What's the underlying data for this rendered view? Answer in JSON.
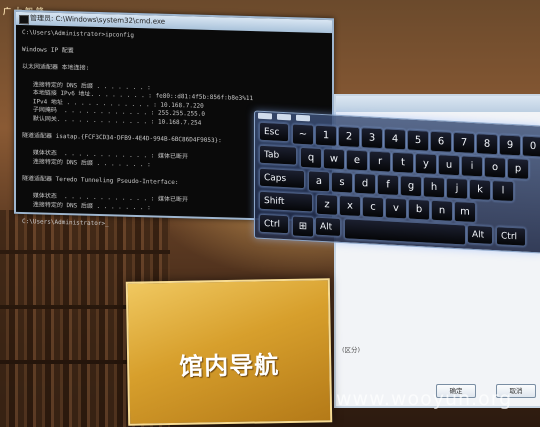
{
  "logo": {
    "text": "广大智锋"
  },
  "console": {
    "title": "管理员: C:\\Windows\\system32\\cmd.exe",
    "lines": [
      "C:\\Users\\Administrator>ipconfig",
      "",
      "Windows IP 配置",
      "",
      "以太网适配器 本地连接:",
      "",
      "   连接特定的 DNS 后缀 . . . . . . . :",
      "   本地链接 IPv6 地址. . . . . . . . : fe80::d81:4f5b:856f:b8e3%11",
      "   IPv4 地址 . . . . . . . . . . . . : 10.168.7.220",
      "   子网掩码  . . . . . . . . . . . . : 255.255.255.0",
      "   默认网关. . . . . . . . . . . . . : 10.168.7.254",
      "",
      "隧道适配器 isatap.{FCF3CD34-DFB9-4E4D-994B-6BC86D4F9053}:",
      "",
      "   媒体状态  . . . . . . . . . . . . : 媒体已断开",
      "   连接特定的 DNS 后缀 . . . . . . . :",
      "",
      "隧道适配器 Teredo Tunneling Pseudo-Interface:",
      "",
      "   媒体状态  . . . . . . . . . . . . : 媒体已断开",
      "   连接特定的 DNS 后缀 . . . . . . . :",
      "",
      "C:\\Users\\Administrator>_"
    ]
  },
  "keyboard": {
    "rows": [
      [
        "Esc",
        "~",
        "1",
        "2",
        "3",
        "4",
        "5",
        "6",
        "7",
        "8",
        "9",
        "0"
      ],
      [
        "Tab",
        "q",
        "w",
        "e",
        "r",
        "t",
        "y",
        "u",
        "i",
        "o",
        "p"
      ],
      [
        "Caps",
        "a",
        "s",
        "d",
        "f",
        "g",
        "h",
        "j",
        "k",
        "l"
      ],
      [
        "Shift",
        "z",
        "x",
        "c",
        "v",
        "b",
        "n",
        "m"
      ],
      [
        "Ctrl",
        "⊞",
        "Alt",
        "",
        "Alt",
        "Ctrl"
      ]
    ]
  },
  "dialog": {
    "field_label": "(区分)",
    "ok_label": "确定",
    "cancel_label": "取消"
  },
  "library_button": {
    "label": "馆内导航"
  },
  "watermark": {
    "text": "www.wooyun.org"
  }
}
